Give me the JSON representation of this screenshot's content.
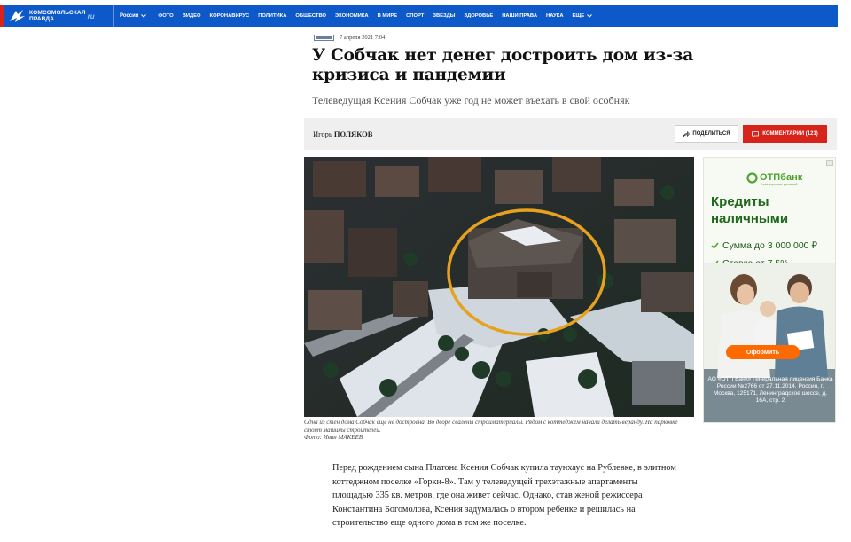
{
  "header": {
    "logo_line1": "Комсомольская",
    "logo_line2": "правда",
    "logo_ru": "ru",
    "region": "Россия",
    "nav": [
      "Фото",
      "Видео",
      "Коронавирус",
      "Политика",
      "Общество",
      "Экономика",
      "В мире",
      "Спорт",
      "Звезды",
      "Здоровье",
      "Наши права",
      "Наука"
    ],
    "nav_more": "Еще"
  },
  "article": {
    "date": "7 апреля 2021 7:04",
    "title": "У Собчак нет денег достроить дом из-за кризиса и пандемии",
    "subtitle": "Телеведущая Ксения Собчак уже год не может въехать в свой особняк",
    "author_first": "Игорь",
    "author_last": "ПОЛЯКОВ",
    "share_label": "Поделиться",
    "comments_label": "Комментарии (121)",
    "caption": "Одна из стен дома Собчак еще не достроена. Во дворе свалены стройматериалы. Рядом с коттеджем начали делать веранду. На парковке стоят машины строителей.",
    "photo_credit": "Фото: Иван МАКЕЕВ",
    "body": "Перед рождением сына Платона Ксения Собчак купила таунхаус на Рублевке, в элитном коттеджном поселке «Горки-8». Там у телеведущей трехэтажные апартаменты площадью 335 кв. метров, где она живет сейчас. Однако, став женой режиссера Константина Богомолова, Ксения задумалась о втором ребенке и решилась на строительство еще одного дома в том же поселке."
  },
  "ad": {
    "brand": "ОТПбанк",
    "brand_sub": "Банк хороших решений",
    "headline": "Кредиты наличными",
    "line1": "Сумма до 3 000 000 ₽",
    "line2": "Ставка от 7,5%",
    "cta": "Оформить",
    "legal": "АО «ОТП Банк» Генеральная лицензия Банка России №2766 от 27.11.2014. Россия, г. Москва, 125171, Ленинградское шоссе, д. 16А, стр. 2"
  },
  "colors": {
    "header_blue": "#0e59c9",
    "accent_red": "#d8231b",
    "ad_green": "#51a32f",
    "ad_orange": "#ff6a00"
  }
}
